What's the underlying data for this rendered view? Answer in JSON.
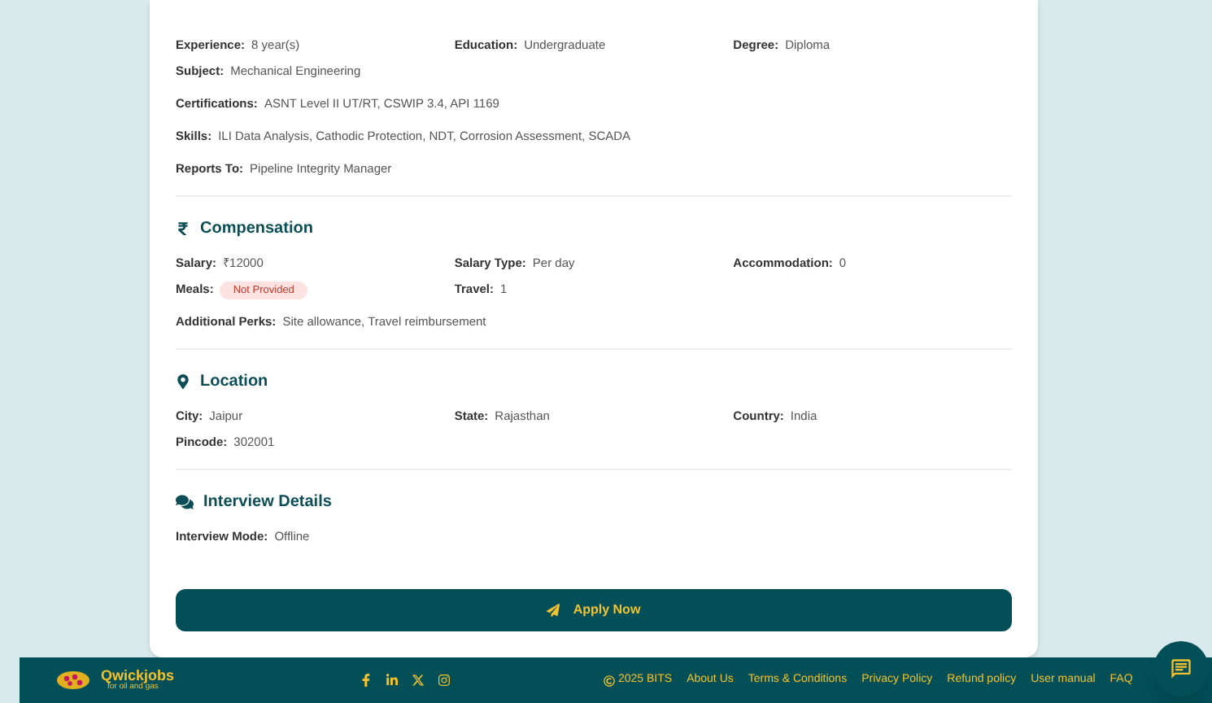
{
  "requirements": {
    "rows": [
      [
        {
          "label": "Experience:",
          "value": "8 year(s)",
          "kind": "text"
        },
        {
          "label": "Education:",
          "value": "Undergraduate",
          "kind": "text"
        },
        {
          "label": "Degree:",
          "value": "Diploma",
          "kind": "text"
        }
      ],
      [
        {
          "label": "Subject:",
          "value": "Mechanical Engineering",
          "kind": "text"
        }
      ],
      [
        {
          "label": "Certifications:",
          "value": "ASNT Level II UT/RT, CSWIP 3.4, API 1169",
          "kind": "text"
        }
      ],
      [
        {
          "label": "Skills:",
          "value": "ILI Data Analysis, Cathodic Protection, NDT, Corrosion Assessment, SCADA",
          "kind": "text"
        }
      ],
      [
        {
          "label": "Reports To:",
          "value": "Pipeline Integrity Manager",
          "kind": "text"
        }
      ]
    ]
  },
  "sections": [
    {
      "kind": "rupee",
      "title": "Compensation",
      "rows": [
        [
          {
            "label": "Salary:",
            "value": "₹12000",
            "kind": "text"
          },
          {
            "label": "Salary Type:",
            "value": "Per day",
            "kind": "text"
          },
          {
            "label": "Accommodation:",
            "value": "0",
            "kind": "text"
          }
        ],
        [
          {
            "label": "Meals:",
            "value": "Not Provided",
            "kind": "badge"
          },
          {
            "label": "Travel:",
            "value": "1",
            "kind": "text"
          }
        ],
        [
          {
            "label": "Additional Perks:",
            "value": "Site allowance, Travel reimbursement",
            "kind": "text"
          }
        ]
      ]
    },
    {
      "kind": "pin",
      "title": "Location",
      "rows": [
        [
          {
            "label": "City:",
            "value": "Jaipur",
            "kind": "text"
          },
          {
            "label": "State:",
            "value": "Rajasthan",
            "kind": "text"
          },
          {
            "label": "Country:",
            "value": "India",
            "kind": "text"
          }
        ],
        [
          {
            "label": "Pincode:",
            "value": "302001",
            "kind": "text"
          }
        ]
      ]
    },
    {
      "kind": "chat",
      "title": "Interview Details",
      "rows": [
        [
          {
            "label": "Interview Mode:",
            "value": "Offline",
            "kind": "text"
          }
        ]
      ]
    }
  ],
  "apply_button": {
    "label": "Apply Now"
  },
  "footer": {
    "brand": "Qwickjobs",
    "tagline": "for oil and gas",
    "copyright": "2025 BITS",
    "links": [
      "About Us",
      "Terms & Conditions",
      "Privacy Policy",
      "Refund policy",
      "User manual",
      "FAQ"
    ]
  }
}
